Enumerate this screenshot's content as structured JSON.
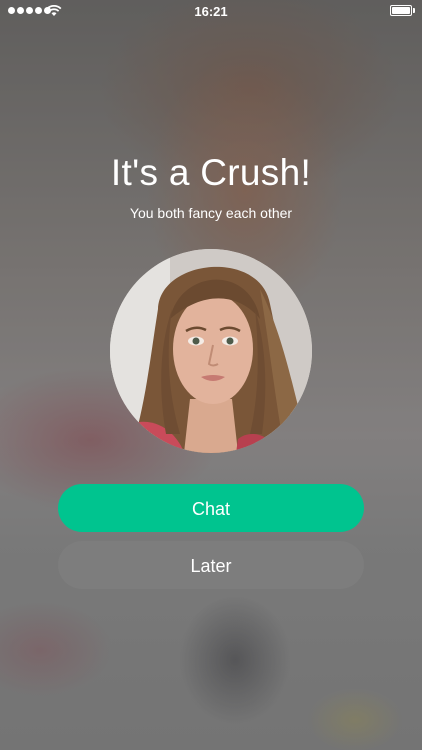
{
  "status_bar": {
    "time": "16:21"
  },
  "match": {
    "title": "It's a Crush!",
    "subtitle": "You both fancy each other"
  },
  "actions": {
    "chat_label": "Chat",
    "later_label": "Later"
  },
  "colors": {
    "accent": "#00c48f",
    "secondary_button": "#7d7d7d",
    "text": "#ffffff"
  },
  "icons": {
    "signal": "signal-dots-icon",
    "wifi": "wifi-icon",
    "battery": "battery-icon"
  }
}
